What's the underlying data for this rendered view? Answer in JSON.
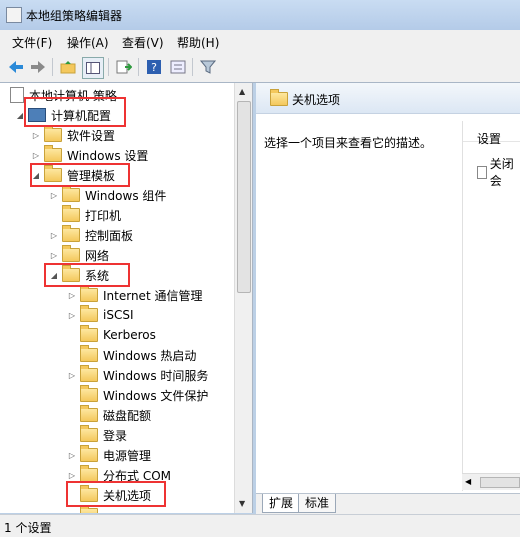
{
  "window": {
    "title": "本地组策略编辑器"
  },
  "menu": [
    "文件(F)",
    "操作(A)",
    "查看(V)",
    "帮助(H)"
  ],
  "toolbar": {
    "icons": [
      "back-arrow-icon",
      "forward-arrow-icon",
      "up-folder-icon",
      "show-hide-tree-icon",
      "export-list-icon",
      "help-icon",
      "properties-icon",
      "filter-icon"
    ]
  },
  "tree": {
    "root": "本地计算机 策略",
    "computer_config": "计算机配置",
    "software_settings": "软件设置",
    "windows_settings": "Windows 设置",
    "admin_templates": "管理模板",
    "windows_components": "Windows 组件",
    "printers": "打印机",
    "control_panel": "控制面板",
    "network": "网络",
    "system": "系统",
    "system_children": [
      "Internet 通信管理",
      "iSCSI",
      "Kerberos",
      "Windows 热启动",
      "Windows 时间服务",
      "Windows 文件保护",
      "磁盘配额",
      "登录",
      "电源管理",
      "分布式 COM",
      "关机选项"
    ]
  },
  "right": {
    "header": "关机选项",
    "description": "选择一个项目来查看它的描述。",
    "column_header": "设置",
    "item": "关闭会"
  },
  "tabs": [
    "扩展",
    "标准"
  ],
  "status": "1 个设置",
  "colors": {
    "highlight_box": "#e33333",
    "folder": "#f4c85d"
  }
}
